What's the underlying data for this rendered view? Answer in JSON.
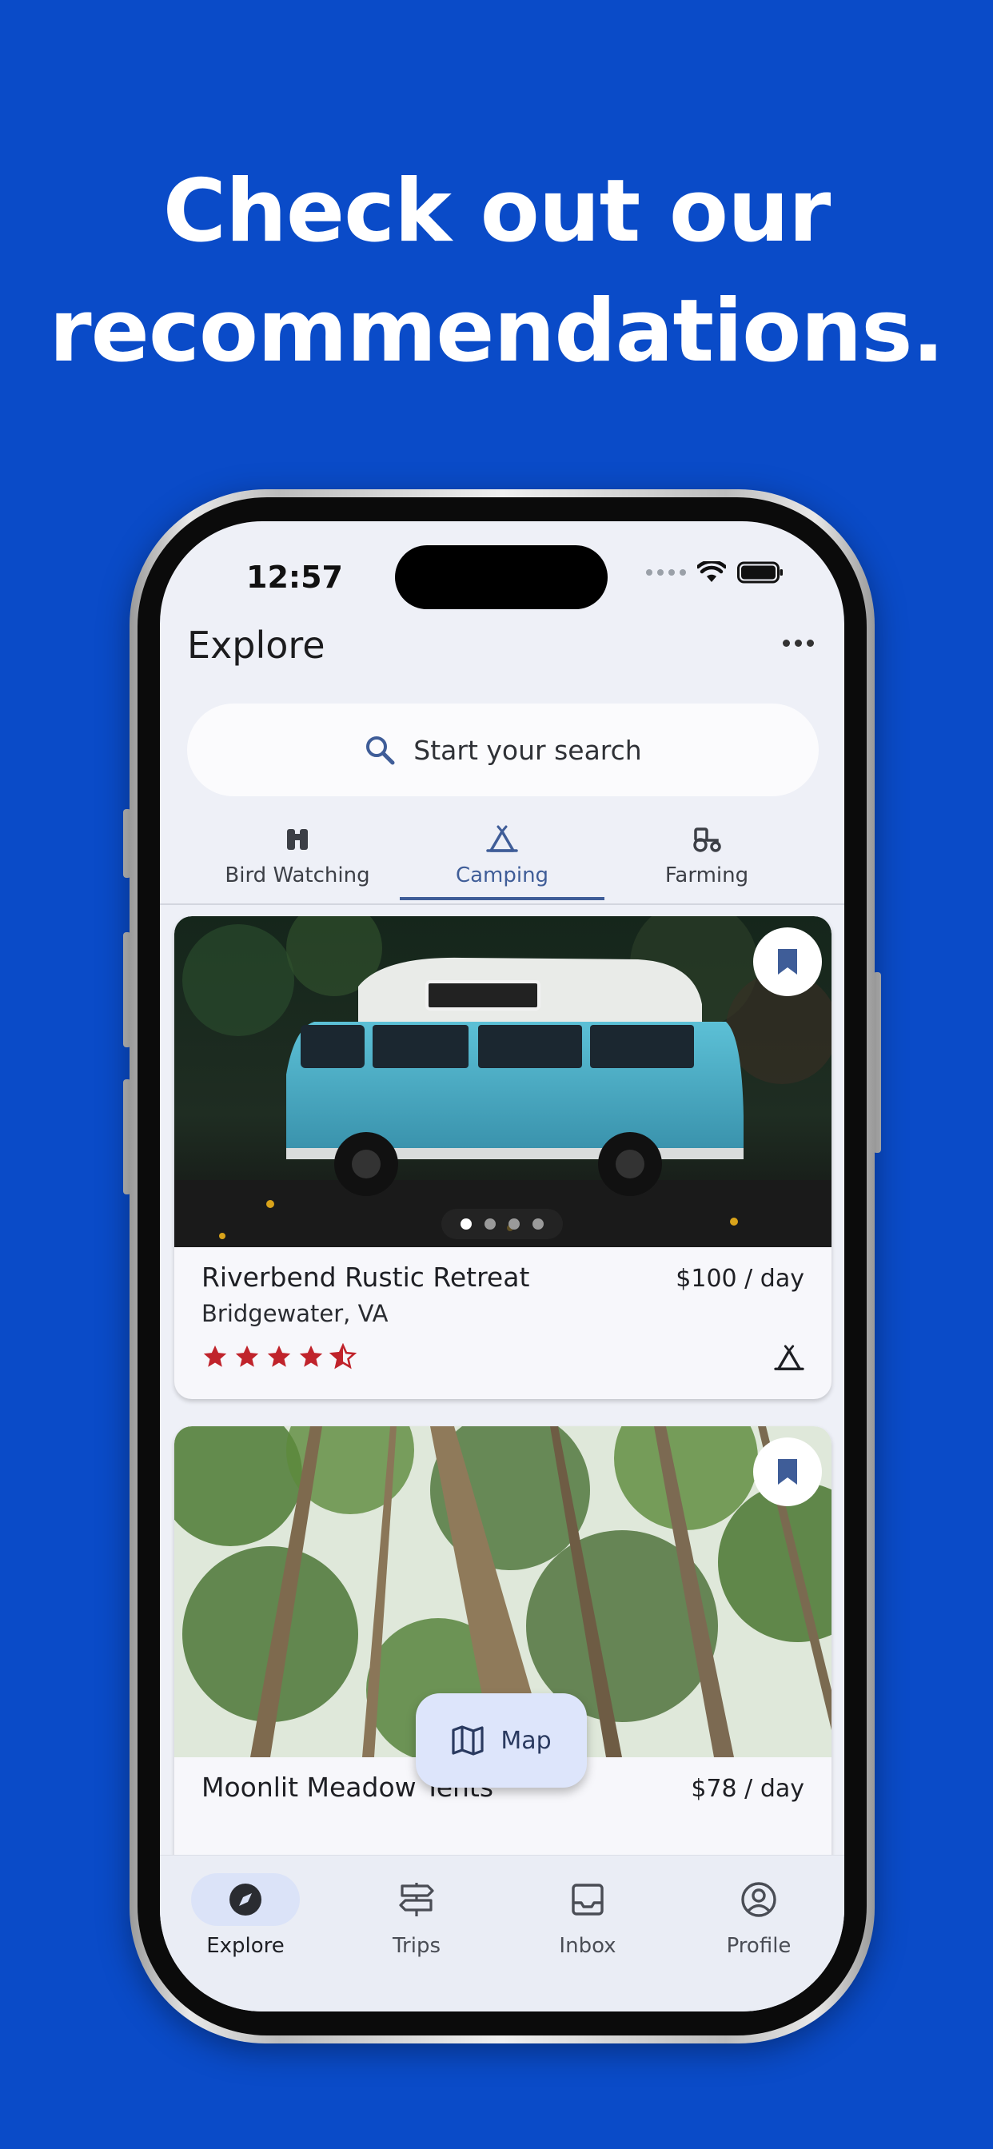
{
  "headline": {
    "line1": "Check out our",
    "line2": "recommendations."
  },
  "colors": {
    "background": "#0a4bc8",
    "accent": "#3f5d98",
    "star": "#c0232b"
  },
  "status": {
    "time": "12:57"
  },
  "header": {
    "title": "Explore",
    "menu_icon": "more-icon"
  },
  "search": {
    "placeholder": "Start your search",
    "icon": "search-icon"
  },
  "categories": [
    {
      "label": "Bird Watching",
      "icon": "binoculars-icon",
      "active": false
    },
    {
      "label": "Camping",
      "icon": "tent-icon",
      "active": true
    },
    {
      "label": "Farming",
      "icon": "tractor-icon",
      "active": false
    }
  ],
  "listings": [
    {
      "title": "Riverbend Rustic Retreat",
      "location": "Bridgewater, VA",
      "price": "$100 / day",
      "rating": 4.5,
      "photo_count": 4,
      "photo_index": 1,
      "saved": true,
      "category_icon": "tent-icon"
    },
    {
      "title": "Moonlit Meadow Tents",
      "price": "$78 / day",
      "saved": true
    }
  ],
  "map_button": {
    "label": "Map",
    "icon": "map-icon"
  },
  "tabs": [
    {
      "label": "Explore",
      "icon": "compass-icon",
      "active": true
    },
    {
      "label": "Trips",
      "icon": "signpost-icon",
      "active": false
    },
    {
      "label": "Inbox",
      "icon": "inbox-icon",
      "active": false
    },
    {
      "label": "Profile",
      "icon": "profile-icon",
      "active": false
    }
  ]
}
